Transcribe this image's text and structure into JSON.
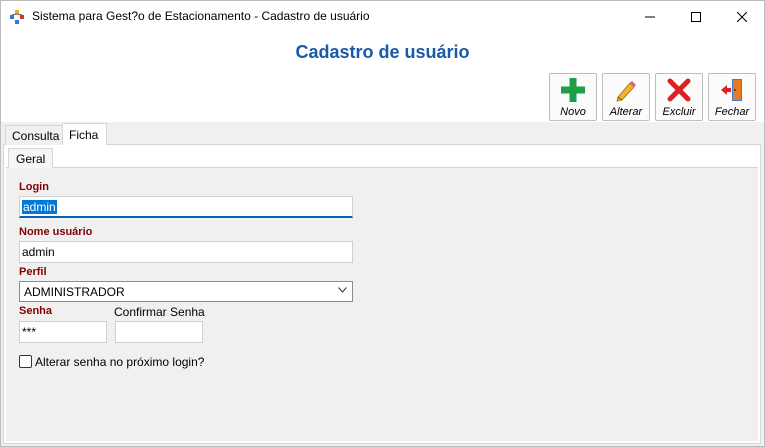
{
  "window": {
    "title": "Sistema para Gest?o de Estacionamento - Cadastro de usuário",
    "controls": [
      "minimize-icon",
      "maximize-icon",
      "close-icon"
    ]
  },
  "header": {
    "title": "Cadastro de usuário",
    "toolbar": {
      "novo": "Novo",
      "alterar": "Alterar",
      "excluir": "Excluir",
      "fechar": "Fechar"
    }
  },
  "tabs": [
    "Consulta",
    "Ficha"
  ],
  "subtabs": [
    "Geral"
  ],
  "form": {
    "login_label": "Login",
    "login_value": "admin",
    "nome_label": "Nome usuário",
    "nome_value": "admin",
    "perfil_label": "Perfil",
    "perfil_value": "ADMINISTRADOR",
    "senha_label": "Senha",
    "senha_value": "***",
    "confirmar_label": "Confirmar Senha",
    "confirmar_value": "",
    "alterar_senha_label": "Alterar senha no próximo login?",
    "alterar_senha_checked": false
  },
  "colors": {
    "title": "#1a5aa8",
    "required_label": "#800000",
    "focus": "#0b5fb4",
    "selection": "#0078d7"
  }
}
